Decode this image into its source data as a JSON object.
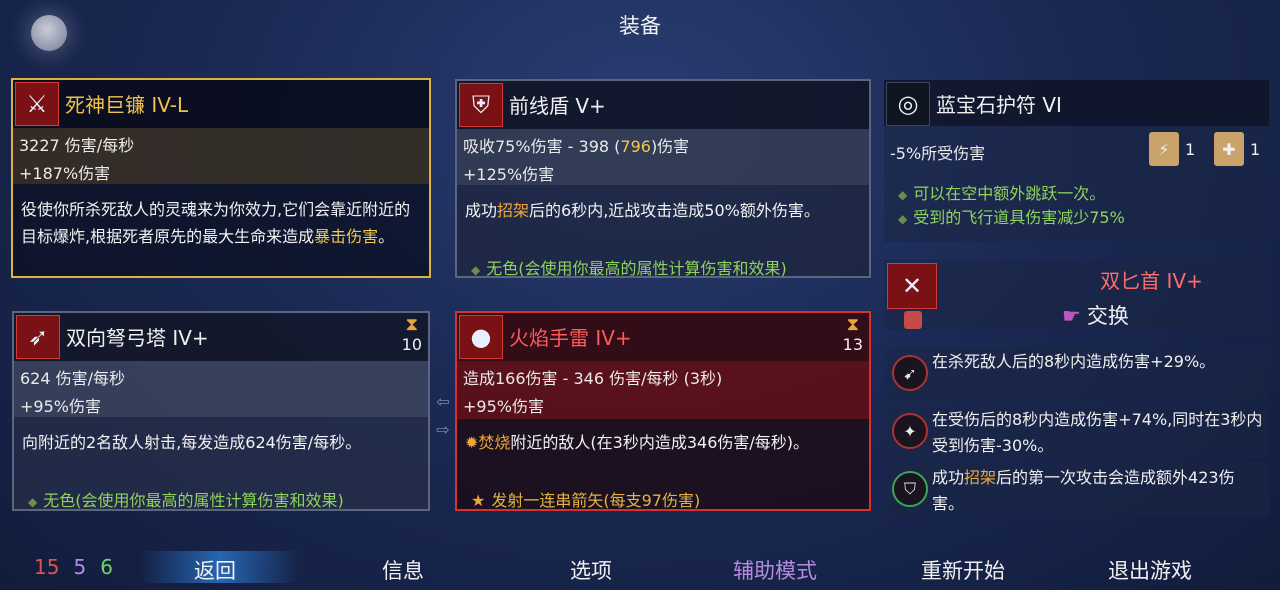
{
  "title": "装备",
  "weapon1": {
    "name": "死神巨镰 IV-L",
    "stat1": "3227 伤害/每秒",
    "stat2": "+187%伤害",
    "desc_a": "役使你所杀死敌人的灵魂来为你效力,它们会靠近附近的目标爆炸,根据死者原先的最大生命来造成",
    "desc_hl": "暴击伤害",
    "desc_b": "。"
  },
  "shield": {
    "name": "前线盾 V+",
    "stat1_a": "吸收75%伤害 - 398 (",
    "stat1_hl": "796",
    "stat1_b": ")伤害",
    "stat2": "+125%伤害",
    "desc_a": "成功",
    "desc_hl": "招架",
    "desc_b": "后的6秒内,近战攻击造成50%额外伤害。",
    "note": "无色(会使用你最高的属性计算伤害和效果)"
  },
  "amulet": {
    "name": "蓝宝石护符 VI",
    "stat": "-5%所受伤害",
    "rune1_count": "1",
    "rune2_count": "1",
    "perk1": "可以在空中额外跳跃一次。",
    "perk2": "受到的飞行道具伤害减少75%"
  },
  "skill1": {
    "name": "双向弩弓塔 IV+",
    "timer": "10",
    "stat1": "624 伤害/每秒",
    "stat2": "+95%伤害",
    "desc": "向附近的2名敌人射击,每发造成624伤害/每秒。",
    "note": "无色(会使用你最高的属性计算伤害和效果)"
  },
  "skill2": {
    "name": "火焰手雷 IV+",
    "timer": "13",
    "stat1": "造成166伤害 - 346 伤害/每秒 (3秒)",
    "stat2": "+95%伤害",
    "desc_hl": "焚烧",
    "desc_b": "附近的敌人(在3秒内造成346伤害/每秒)。",
    "note": "发射一连串箭矢(每支97伤害)"
  },
  "swap": {
    "title": "双匕首 IV+",
    "action": "交换",
    "perk1": "在杀死敌人后的8秒内造成伤害+29%。",
    "perk2": "在受伤后的8秒内造成伤害+74%,同时在3秒内受到伤害-30%。",
    "perk3_a": "成功",
    "perk3_hl": "招架",
    "perk3_b": "后的第一次攻击会造成额外423伤害。"
  },
  "stats": {
    "red": "15",
    "purple": "5",
    "green": "6"
  },
  "menu": {
    "back": "返回",
    "info": "信息",
    "options": "选项",
    "assist": "辅助模式",
    "restart": "重新开始",
    "quit": "退出游戏"
  },
  "colors": {
    "red_stat": "#e0524f",
    "purple_stat": "#b28ae6",
    "green_stat": "#6fd36a",
    "assist": "#b58ae0"
  }
}
